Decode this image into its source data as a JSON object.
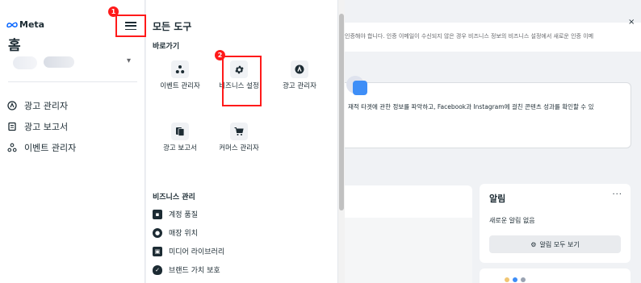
{
  "brand": {
    "name": "Meta"
  },
  "sidebar": {
    "home_title": "홈",
    "items": [
      {
        "label": "광고 관리자",
        "icon": "ads-manager-icon"
      },
      {
        "label": "광고 보고서",
        "icon": "ads-report-icon"
      },
      {
        "label": "이벤트 관리자",
        "icon": "events-manager-icon"
      }
    ]
  },
  "annotations": {
    "step1": "1",
    "step2": "2",
    "highlight_color": "#ff1a1a"
  },
  "tools": {
    "title": "모든 도구",
    "shortcuts_label": "바로가기",
    "shortcuts": [
      {
        "label": "이벤트 관리자",
        "icon": "events-manager-icon"
      },
      {
        "label": "비즈니스 설정",
        "icon": "gear-icon"
      },
      {
        "label": "광고 관리자",
        "icon": "ads-manager-icon"
      },
      {
        "label": "광고 보고서",
        "icon": "ads-report-icon"
      },
      {
        "label": "커머스 관리자",
        "icon": "cart-icon"
      }
    ],
    "business_label": "비즈니스 관리",
    "business_items": [
      {
        "label": "계정 품질",
        "icon": "shield-icon"
      },
      {
        "label": "매장 위치",
        "icon": "location-icon"
      },
      {
        "label": "미디어 라이브러리",
        "icon": "media-icon"
      },
      {
        "label": "브랜드 가치 보호",
        "icon": "shield-check-icon"
      }
    ]
  },
  "main": {
    "notice": "인증해야 합니다. 인증 이메일이 수신되지 않은 경우 비즈니스 정보의 비즈니스 설정에서 새로운 인증 이메",
    "close": "×",
    "info_text": "재적 타겟에 관한 정보를 파악하고, Facebook과 Instagram에 걸친 콘텐츠 성과를 확인할 수 있",
    "alerts_title": "알림",
    "alerts_more": "···",
    "alerts_empty": "새로운 알림 없음",
    "alerts_button": "알림 모두 보기"
  }
}
